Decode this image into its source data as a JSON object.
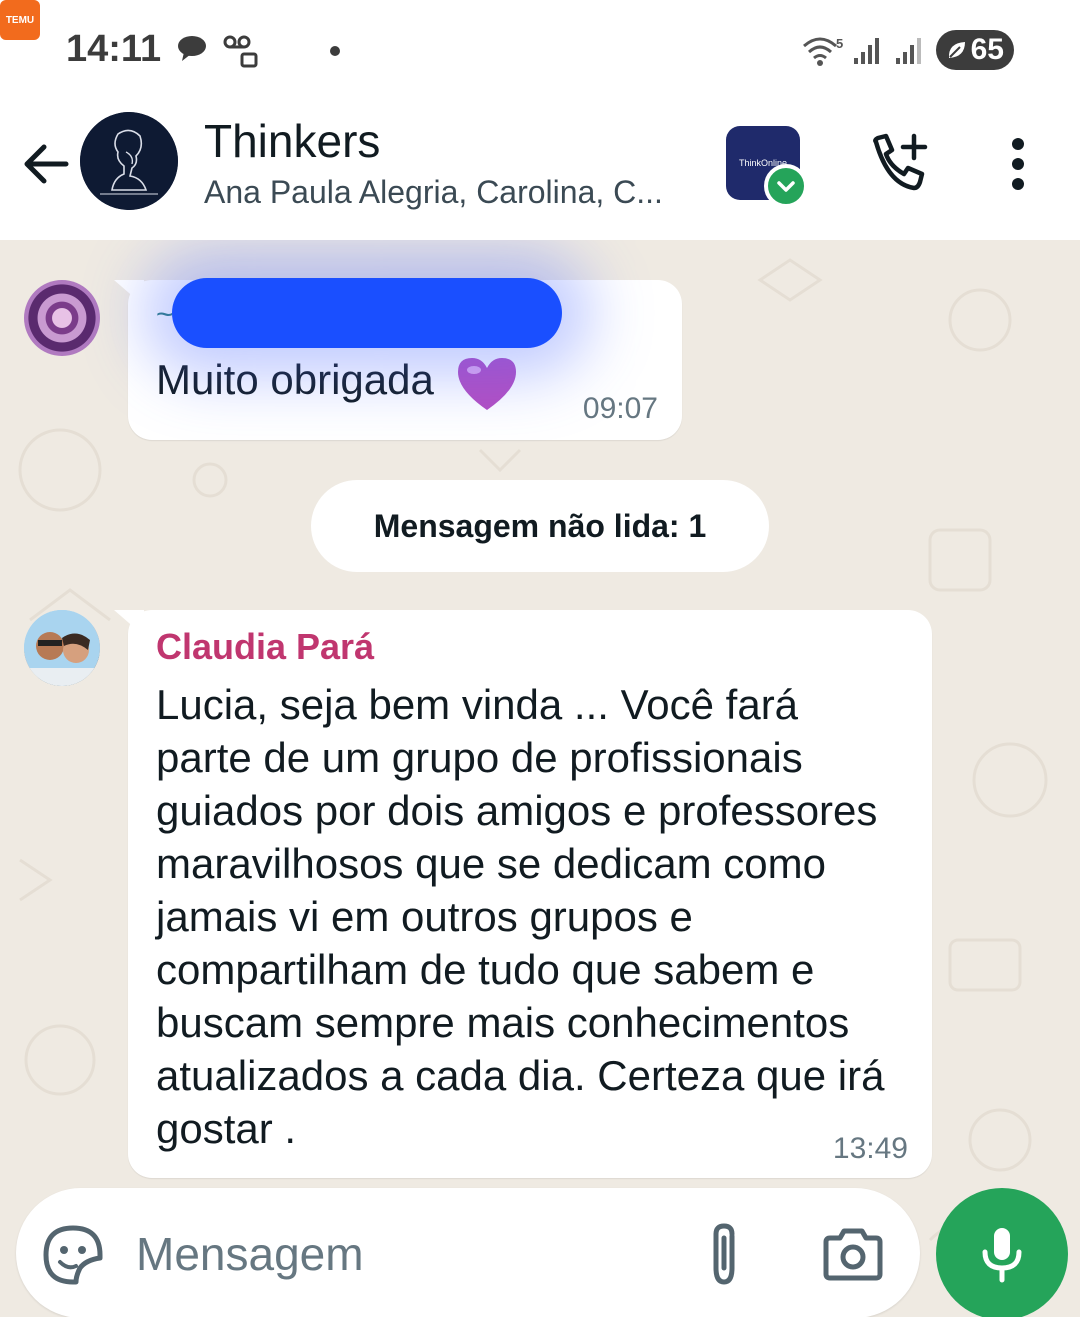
{
  "status_bar": {
    "time": "14:11",
    "temu_label": "TEMU",
    "wifi_badge": "5",
    "battery": "65"
  },
  "header": {
    "title": "Thinkers",
    "members": "Ana Paula Alegria, Carolina, C...",
    "app_badge_label": "ThinkOnline"
  },
  "messages": [
    {
      "sender": "~",
      "text": "Muito obrigada",
      "time": "09:07"
    },
    {
      "sender": "Claudia Pará",
      "text": "Lucia, seja bem vinda ... Você fará parte de um grupo de profissionais guiados por dois amigos e professores maravilhosos que se dedicam como jamais vi em outros grupos e compartilham de tudo que sabem e buscam sempre mais conhecimentos atualizados a cada dia. Certeza que irá gostar .",
      "time": "13:49"
    }
  ],
  "unread_banner": "Mensagem não lida: 1",
  "input": {
    "placeholder": "Mensagem"
  },
  "colors": {
    "accent_green": "#25a45a",
    "sender_pink": "#c0366f",
    "chat_bg": "#efeae2",
    "redaction_blue": "#1a4fff"
  },
  "icons": [
    "chat-bubble-icon",
    "voicemail-icon",
    "temu-icon",
    "wifi-icon",
    "signal-icon",
    "battery-icon",
    "back-arrow-icon",
    "add-call-icon",
    "more-vert-icon",
    "sticker-icon",
    "paperclip-icon",
    "camera-icon",
    "mic-icon"
  ]
}
